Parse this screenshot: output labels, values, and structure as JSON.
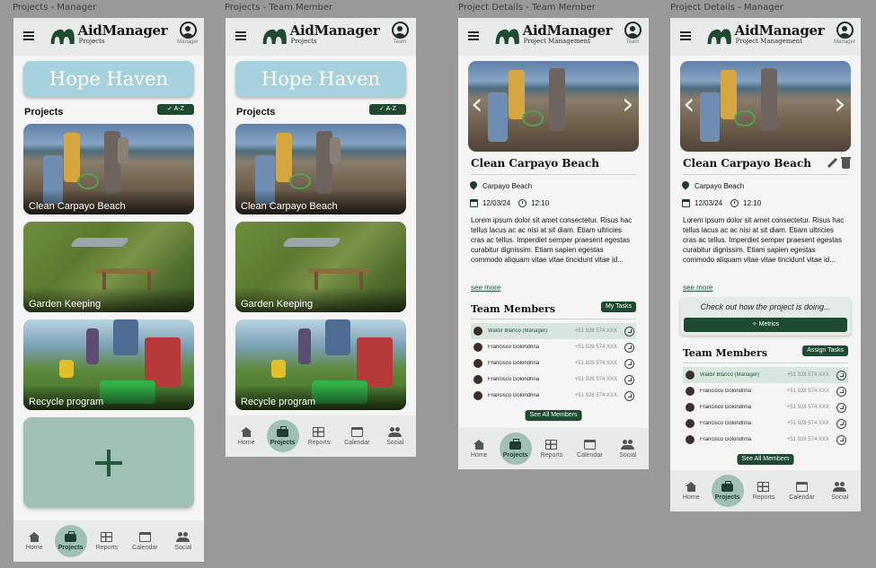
{
  "frames": [
    {
      "label": "Projects - Manager"
    },
    {
      "label": "Projects - Team Member"
    },
    {
      "label": "Project Details - Team Member"
    },
    {
      "label": "Project Details - Manager"
    }
  ],
  "brand": {
    "name": "AidManager",
    "sub_projects": "Projects",
    "sub_details": "Project Management"
  },
  "profile": {
    "manager": "Manager",
    "team": "Team"
  },
  "org_name": "Hope Haven",
  "projects_section": {
    "title": "Projects",
    "sort_label": "✓  A-Z"
  },
  "projects": [
    {
      "name": "Clean Carpayo Beach"
    },
    {
      "name": "Garden Keeping"
    },
    {
      "name": "Recycle program"
    }
  ],
  "nav": [
    {
      "label": "Home",
      "icon": "home-icon"
    },
    {
      "label": "Projects",
      "icon": "briefcase-icon"
    },
    {
      "label": "Reports",
      "icon": "grid-icon"
    },
    {
      "label": "Calendar",
      "icon": "calendar-icon"
    },
    {
      "label": "Social",
      "icon": "people-icon"
    }
  ],
  "detail": {
    "title": "Clean Carpayo Beach",
    "location": "Carpayo Beach",
    "date": "12/03/24",
    "time": "12:10",
    "description": "Lorem ipsum dolor sit amet consectetur. Risus hac tellus lacus ac ac nisi at sit diam. Etiam ultricies cras ac tellus. Imperdiet semper praesent egestas curabitur dignissim. Etiam sapien egestas commodo aliquam vitae vitae tincidunt vitae id...",
    "see_more": "see more",
    "team_title": "Team Members",
    "my_tasks": "My Tasks",
    "assign_tasks": "Assign Tasks",
    "see_all": "See All Members",
    "metrics_prompt": "Check out how the project is doing...",
    "metrics_label": "Metrics",
    "members": [
      {
        "name": "Waldir Blanco (Manager)",
        "phone": "+51 928 574 XXX"
      },
      {
        "name": "Francisco Golondrina",
        "phone": "+51 928 574 XXX"
      },
      {
        "name": "Francisco Golondrina",
        "phone": "+51 928 574 XXX"
      },
      {
        "name": "Francisco Golondrina",
        "phone": "+51 928 574 XXX"
      },
      {
        "name": "Francisco Golondrina",
        "phone": "+51 928 574 XXX"
      }
    ]
  },
  "colors": {
    "accent": "#1d4a31",
    "active_nav": "#9fc0b3",
    "banner": "#a5d2dd",
    "add_card": "#9fc0b3"
  }
}
